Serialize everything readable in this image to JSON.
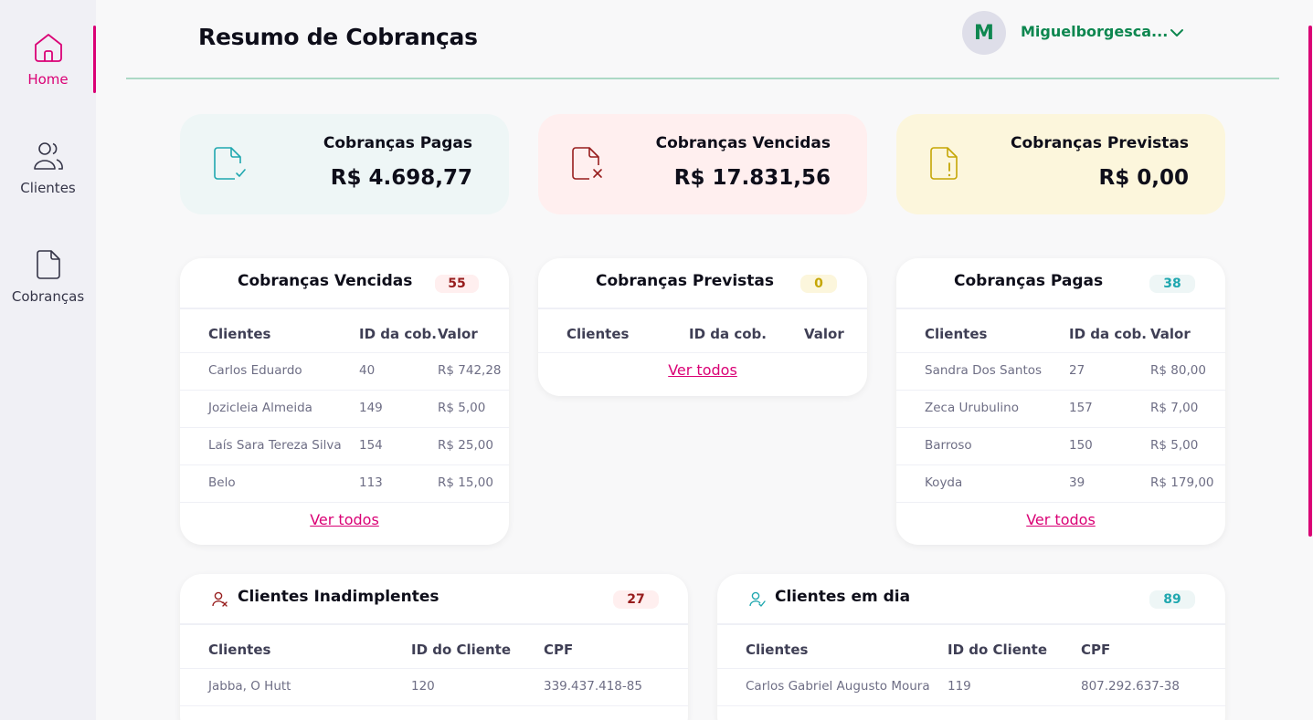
{
  "sidebar": {
    "items": [
      {
        "label": "Home",
        "icon": "home-icon",
        "active": true
      },
      {
        "label": "Clientes",
        "icon": "users-icon"
      },
      {
        "label": "Cobranças",
        "icon": "document-icon"
      }
    ]
  },
  "header": {
    "title": "Resumo de Cobranças",
    "avatar_initial": "M",
    "user_name": "Miguelborgesca..."
  },
  "summary": {
    "paid": {
      "title": "Cobranças Pagas",
      "value": "R$ 4.698,77"
    },
    "overdue": {
      "title": "Cobranças Vencidas",
      "value": "R$ 17.831,56"
    },
    "pending": {
      "title": "Cobranças Previstas",
      "value": "R$ 0,00"
    }
  },
  "overdue_list": {
    "title": "Cobranças Vencidas",
    "count": "55",
    "columns": [
      "Clientes",
      "ID da cob.",
      "Valor"
    ],
    "rows": [
      [
        "Carlos Eduardo",
        "40",
        "R$ 742,28"
      ],
      [
        "Jozicleia Almeida",
        "149",
        "R$ 5,00"
      ],
      [
        "Laís Sara Tereza Silva",
        "154",
        "R$ 25,00"
      ],
      [
        "Belo",
        "113",
        "R$ 15,00"
      ]
    ],
    "see_all": "Ver todos"
  },
  "pending_list": {
    "title": "Cobranças Previstas",
    "count": "0",
    "columns": [
      "Clientes",
      "ID da cob.",
      "Valor"
    ],
    "see_all": "Ver todos"
  },
  "paid_list": {
    "title": "Cobranças Pagas",
    "count": "38",
    "columns": [
      "Clientes",
      "ID da cob.",
      "Valor"
    ],
    "rows": [
      [
        "Sandra Dos Santos",
        "27",
        "R$ 80,00"
      ],
      [
        "Zeca Urubulino",
        "157",
        "R$ 7,00"
      ],
      [
        "Barroso",
        "150",
        "R$ 5,00"
      ],
      [
        "Koyda",
        "39",
        "R$ 179,00"
      ]
    ],
    "see_all": "Ver todos"
  },
  "defaulters": {
    "title": "Clientes Inadimplentes",
    "count": "27",
    "columns": [
      "Clientes",
      "ID do Cliente",
      "CPF"
    ],
    "rows": [
      [
        "Jabba, O Hutt",
        "120",
        "339.437.418-85"
      ]
    ]
  },
  "up_to_date": {
    "title": "Clientes em dia",
    "count": "89",
    "columns": [
      "Clientes",
      "ID do Cliente",
      "CPF"
    ],
    "rows": [
      [
        "Carlos Gabriel Augusto Moura",
        "119",
        "807.292.637-38"
      ]
    ]
  },
  "colors": {
    "accent": "#DA0175",
    "brand_green": "#0E8750",
    "paid_bg": "#EEF6F6",
    "overdue_bg": "#FFEFEF",
    "pending_bg": "#FCF6DC"
  }
}
